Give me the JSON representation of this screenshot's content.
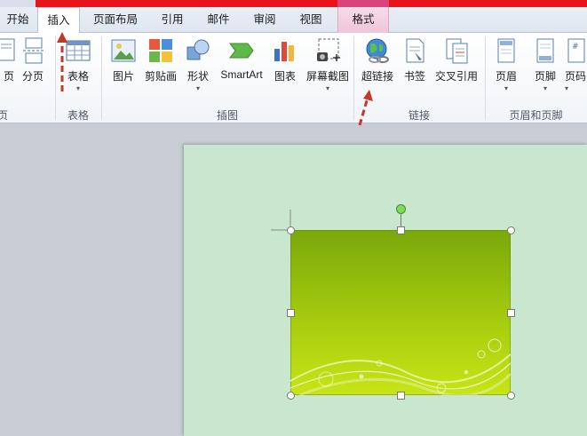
{
  "tabs": [
    {
      "label": "开始"
    },
    {
      "label": "插入"
    },
    {
      "label": "页面布局"
    },
    {
      "label": "引用"
    },
    {
      "label": "邮件"
    },
    {
      "label": "审阅"
    },
    {
      "label": "视图"
    },
    {
      "label": "格式"
    }
  ],
  "groups": {
    "pages": {
      "buttons": [
        {
          "label": "页"
        },
        {
          "label": "分页"
        }
      ],
      "label": "页"
    },
    "tables": {
      "buttons": [
        {
          "label": "表格"
        }
      ],
      "label": "表格"
    },
    "illustrations": {
      "buttons": [
        {
          "label": "图片"
        },
        {
          "label": "剪贴画"
        },
        {
          "label": "形状"
        },
        {
          "label": "SmartArt"
        },
        {
          "label": "图表"
        },
        {
          "label": "屏幕截图"
        }
      ],
      "label": "插图"
    },
    "links": {
      "buttons": [
        {
          "label": "超链接"
        },
        {
          "label": "书签"
        },
        {
          "label": "交叉引用"
        }
      ],
      "label": "链接"
    },
    "header_footer": {
      "buttons": [
        {
          "label": "页眉"
        },
        {
          "label": "页脚"
        },
        {
          "label": "页码"
        }
      ],
      "label": "页眉和页脚"
    }
  },
  "colors": {
    "accent_red": "#e8141c",
    "context_pink": "#d9457a",
    "annotation_arrow": "#c0392b",
    "page_bg": "#c9e6cf"
  }
}
